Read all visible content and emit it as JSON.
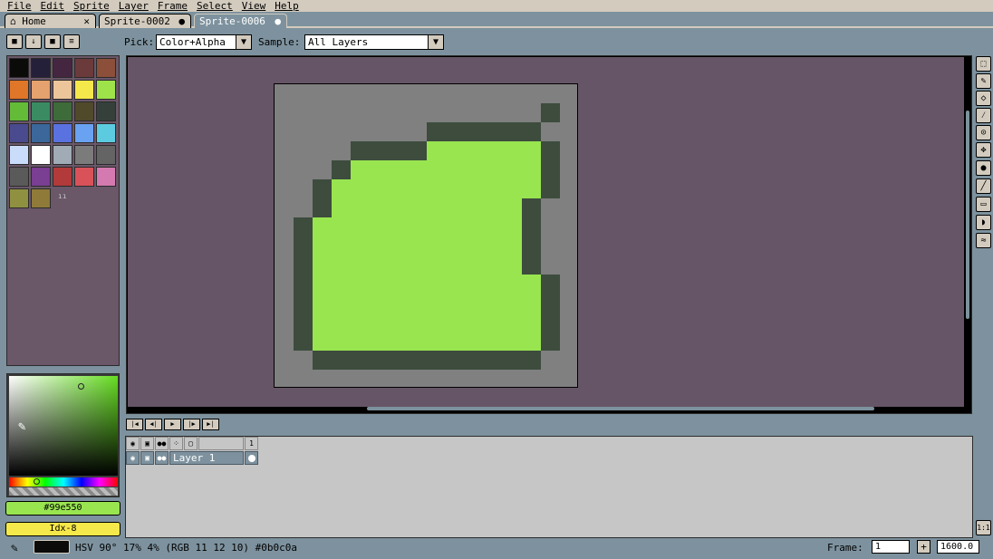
{
  "menu": [
    "File",
    "Edit",
    "Sprite",
    "Layer",
    "Frame",
    "Select",
    "View",
    "Help"
  ],
  "tabs": [
    {
      "label": "Home",
      "close": "✕"
    },
    {
      "label": "Sprite-0002",
      "close": "●"
    },
    {
      "label": "Sprite-0006",
      "close": "●"
    }
  ],
  "context": {
    "pick_label": "Pick:",
    "pick_value": "Color+Alpha",
    "sample_label": "Sample:",
    "sample_value": "All Layers"
  },
  "palette_colors": [
    "#0b0c0a",
    "#25203a",
    "#452641",
    "#6b3a3a",
    "#8b4f3a",
    "#e07628",
    "#e5a16e",
    "#ecc69a",
    "#f5e84a",
    "#9ee34a",
    "#63bb38",
    "#3a8b62",
    "#3e6b3a",
    "#504a2a",
    "#35403b",
    "#4a4a8e",
    "#3b679a",
    "#5a72e0",
    "#6aa2f2",
    "#5ccbe0",
    "#c9dcfa",
    "#ffffff",
    "#a0abb5",
    "#7b7b7b",
    "#646464",
    "#5a5a5a",
    "#7a3e92",
    "#b23a3a",
    "#d9525a",
    "#d57ab0",
    "#8f9141",
    "#8f7a3a"
  ],
  "palette_page_marker": "ıı",
  "color_hex": "#99e550",
  "color_index": "Idx-8",
  "colors": {
    "foreground_bar": "#99e550",
    "index_bar": "#f5e84a",
    "canvas_bg": "#665566",
    "sprite_bg": "#808080",
    "outline": "#3d4c3d",
    "fill": "#99e550"
  },
  "sprite_grid": [
    "................",
    "..............O.",
    "........OOOOOO..",
    "....OOOOFFFFFFO.",
    "...OFFFFFFFFFFO.",
    "..OFFFFFFFFFFFO.",
    "..OFFFFFFFFFFO..",
    ".OFFFFFFFFFFFO..",
    ".OFFFFFFFFFFFO..",
    ".OFFFFFFFFFFFO..",
    ".OFFFFFFFFFFFFO.",
    ".OFFFFFFFFFFFFO.",
    ".OFFFFFFFFFFFFO.",
    ".OFFFFFFFFFFFFO.",
    "..OOOOOOOOOOOO..",
    "................"
  ],
  "timeline": {
    "frame_header": "1",
    "layer_name": "Layer 1",
    "buttons": [
      "first-frame",
      "prev-frame",
      "play",
      "next-frame",
      "last-frame"
    ]
  },
  "status": {
    "color_info": "HSV 90° 17% 4% (RGB 11 12 10) #0b0c0a",
    "frame_label": "Frame:",
    "frame_value": "1",
    "zoom_value": "1600.0",
    "fit_label": "1:1"
  },
  "tool_icons": [
    "marquee-icon",
    "pencil-icon",
    "eraser-icon",
    "eyedropper-icon",
    "zoom-icon",
    "move-icon",
    "fill-icon",
    "line-icon",
    "rectangle-icon",
    "contour-icon",
    "blur-icon"
  ]
}
